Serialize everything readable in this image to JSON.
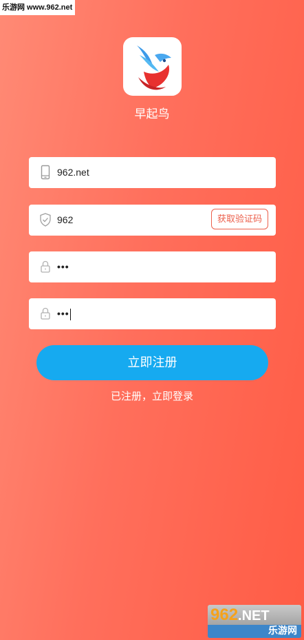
{
  "watermark": {
    "text": "乐游网 www.962.net"
  },
  "app": {
    "logo_icon": "bird-logo-icon",
    "name": "早起鸟"
  },
  "form": {
    "phone": {
      "icon": "phone-icon",
      "value": "962.net"
    },
    "code": {
      "icon": "shield-icon",
      "value": "962",
      "button_label": "获取验证码"
    },
    "password": {
      "icon": "lock-icon",
      "value": "•••"
    },
    "confirm_password": {
      "icon": "lock-icon",
      "value": "•••"
    }
  },
  "actions": {
    "register_label": "立即注册",
    "login_link": "已注册，立即登录"
  },
  "brand_badge": {
    "number": "962",
    "suffix": ".NET",
    "subtitle": "乐游网"
  },
  "colors": {
    "background_start": "#ff8a75",
    "background_end": "#ff5c45",
    "primary_button": "#16aaf0",
    "code_button_accent": "#ec5f4b"
  }
}
